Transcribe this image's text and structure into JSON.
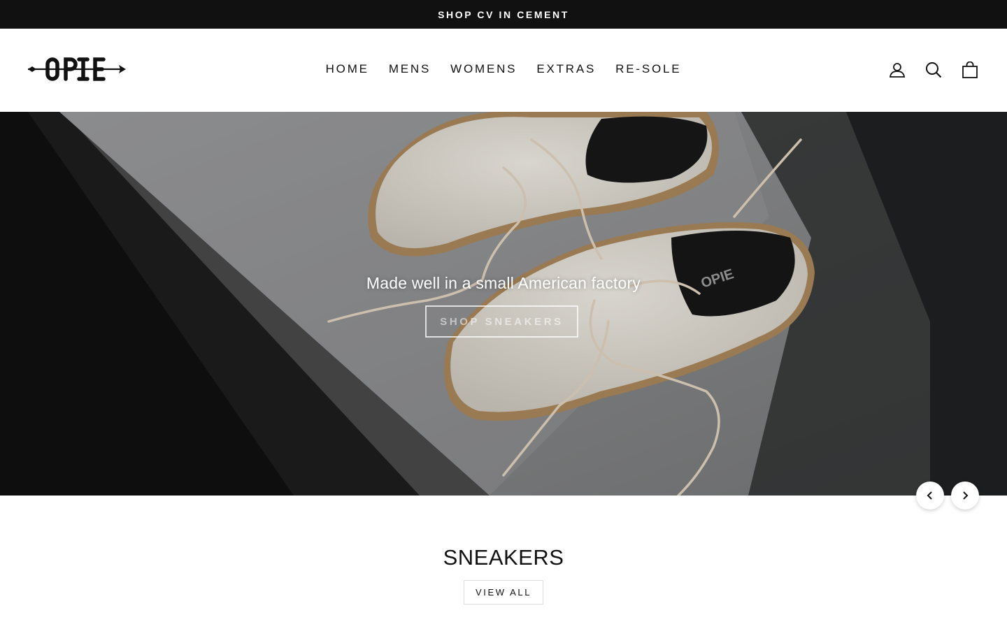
{
  "announcement": {
    "text": "SHOP CV IN CEMENT"
  },
  "header": {
    "logo_text": "OPIE",
    "nav": [
      "HOME",
      "MENS",
      "WOMENS",
      "EXTRAS",
      "RE-SOLE"
    ],
    "icons": [
      "user-icon",
      "search-icon",
      "bag-icon"
    ]
  },
  "hero": {
    "headline": "Made well in a small American factory",
    "button_label": "SHOP SNEAKERS",
    "insole_brand_text": "OPIE"
  },
  "slider": {
    "prev_icon": "chevron-left-icon",
    "next_icon": "chevron-right-icon"
  },
  "collection": {
    "title": "SNEAKERS",
    "view_all_label": "VIEW ALL"
  },
  "colors": {
    "announcement_bg": "#111111",
    "text": "#111111",
    "hero_floor": "#7d7e7f"
  }
}
